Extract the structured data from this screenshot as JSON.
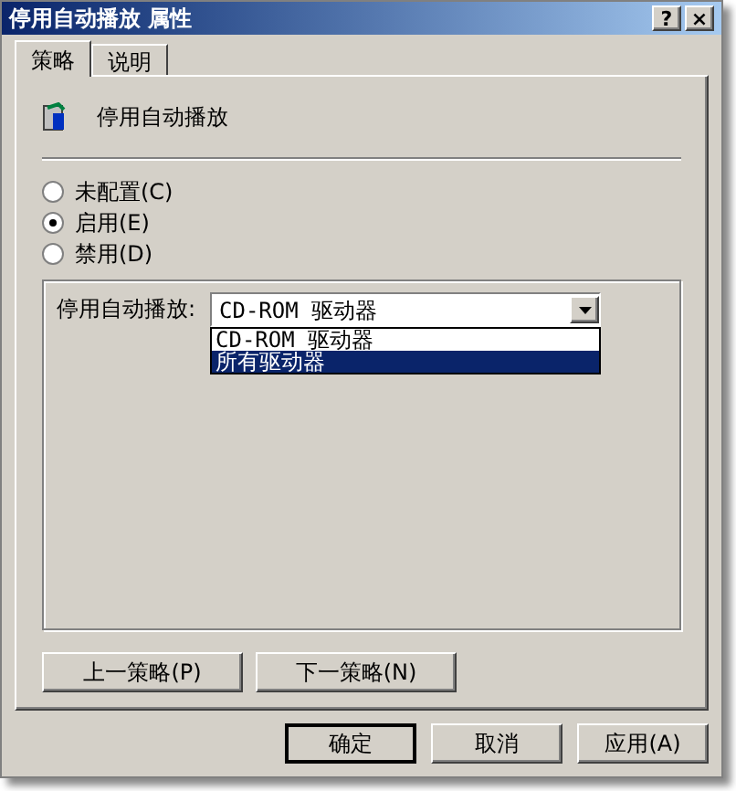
{
  "window": {
    "title": "停用自动播放 属性",
    "controls": [
      "?",
      "×"
    ]
  },
  "tabs": [
    {
      "label": "策略",
      "selected": true
    },
    {
      "label": "说明",
      "selected": false
    }
  ],
  "policy": {
    "name": "停用自动播放"
  },
  "options": [
    {
      "label": "未配置(C)",
      "selected": false
    },
    {
      "label": "启用(E)",
      "selected": true
    },
    {
      "label": "禁用(D)",
      "selected": false
    }
  ],
  "setting": {
    "label": "停用自动播放:",
    "value": "CD-ROM 驱动器",
    "expanded": true,
    "items": [
      {
        "label": "CD-ROM 驱动器",
        "highlighted": false
      },
      {
        "label": "所有驱动器",
        "highlighted": true
      }
    ]
  },
  "nav_buttons": [
    "上一策略(P)",
    "下一策略(N)"
  ],
  "buttons": [
    {
      "label": "确定",
      "default": true
    },
    {
      "label": "取消",
      "default": false
    },
    {
      "label": "应用(A)",
      "default": false
    }
  ]
}
